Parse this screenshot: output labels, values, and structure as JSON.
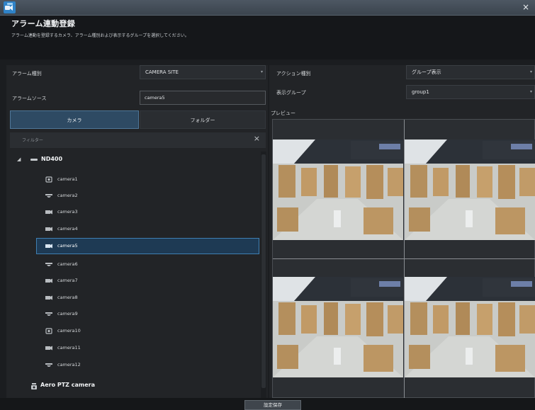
{
  "window": {
    "close_glyph": "×",
    "app_icon": "app-icon"
  },
  "header": {
    "title": "アラーム連動登録",
    "description": "アラーム連動を登録するカメラ、アラーム種別および表示するグループを選択してください。"
  },
  "left": {
    "alarm_type_label": "アラーム種別",
    "alarm_type_value": "CAMERA SITE",
    "alarm_source_label": "アラームソース",
    "alarm_source_value": "camera5",
    "tabs": [
      {
        "label": "カメラ",
        "active": true
      },
      {
        "label": "フォルダー",
        "active": false
      }
    ],
    "filter_placeholder": "フィルター",
    "filter_clear": "×",
    "tree": {
      "root_toggle": "◢",
      "root_label": "ND400",
      "cameras": [
        {
          "label": "camera1",
          "icon": "dome-camera-icon",
          "selected": false
        },
        {
          "label": "camera2",
          "icon": "fisheye-camera-icon",
          "selected": false
        },
        {
          "label": "camera3",
          "icon": "box-camera-icon",
          "selected": false
        },
        {
          "label": "camera4",
          "icon": "box-camera-icon",
          "selected": false
        },
        {
          "label": "camera5",
          "icon": "box-camera-icon",
          "selected": true
        },
        {
          "label": "camera6",
          "icon": "fisheye-camera-icon",
          "selected": false
        },
        {
          "label": "camera7",
          "icon": "box-camera-icon",
          "selected": false
        },
        {
          "label": "camera8",
          "icon": "box-camera-icon",
          "selected": false
        },
        {
          "label": "camera9",
          "icon": "fisheye-camera-icon",
          "selected": false
        },
        {
          "label": "camera10",
          "icon": "dome-camera-icon",
          "selected": false
        },
        {
          "label": "camera11",
          "icon": "box-camera-icon",
          "selected": false
        },
        {
          "label": "camera12",
          "icon": "fisheye-camera-icon",
          "selected": false
        }
      ],
      "ptz_label": "Aero PTZ camera"
    }
  },
  "right": {
    "action_type_label": "アクション種別",
    "action_type_value": "グループ表示",
    "display_group_label": "表示グループ",
    "display_group_value": "group1",
    "preview_label": "プレビュー"
  },
  "footer": {
    "save_label": "設定保存"
  },
  "colors": {
    "accent": "#3f7fb2",
    "selected_bg": "#1e3a54",
    "panel": "#222427",
    "background": "#1b1d20"
  }
}
